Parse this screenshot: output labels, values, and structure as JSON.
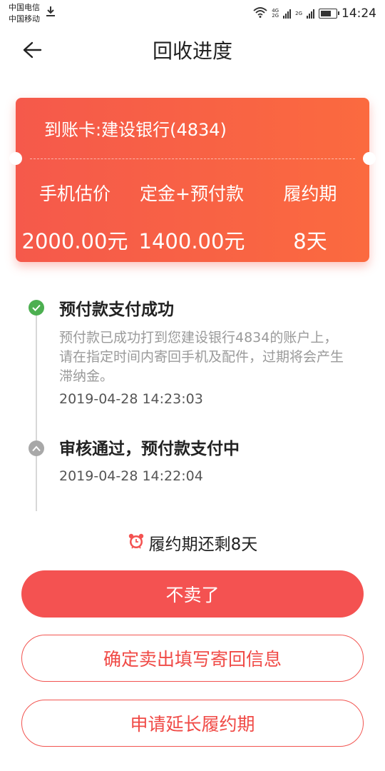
{
  "status_bar": {
    "carrier_1": "中国电信",
    "carrier_2": "中国移动",
    "net_1_top": "4G",
    "net_1_bottom": "2G",
    "net_2": "2G",
    "time": "14:24"
  },
  "header": {
    "title": "回收进度",
    "back_icon": "back-arrow-icon"
  },
  "card": {
    "account": "到账卡:建设银行(4834)",
    "columns": [
      {
        "label": "手机估价",
        "value": "2000.00元"
      },
      {
        "label": "定金+预付款",
        "value": "1400.00元"
      },
      {
        "label": "履约期",
        "value": "8天"
      }
    ],
    "colors": {
      "start": "#f5594b",
      "end": "#fb6a3f"
    }
  },
  "timeline": [
    {
      "status_icon": "check-icon",
      "color": "#4caf50",
      "title": "预付款支付成功",
      "description": "预付款已成功打到您建设银行4834的账户上，请在指定时间内寄回手机及配件，过期将会产生滞纳金。",
      "time": "2019-04-28 14:23:03"
    },
    {
      "status_icon": "chevron-up-icon",
      "color": "#a8a8a8",
      "title": "审核通过，预付款支付中",
      "time": "2019-04-28 14:22:04"
    }
  ],
  "remaining": {
    "icon": "alarm-clock-icon",
    "text": "履约期还剩8天"
  },
  "buttons": {
    "cancel": "不卖了",
    "confirm": "确定卖出填写寄回信息",
    "extend": "申请延长履约期"
  },
  "theme": {
    "accent": "#f45251"
  }
}
